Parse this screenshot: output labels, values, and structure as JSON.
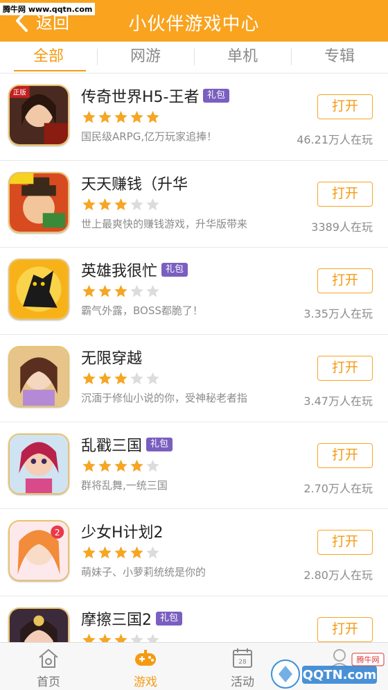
{
  "watermark_top": "腾牛网 www.qqtn.com",
  "header": {
    "back_label": "返回",
    "title": "小伙伴游戏中心",
    "color": "#f9a31f"
  },
  "tabs": [
    {
      "label": "全部",
      "active": true
    },
    {
      "label": "网游",
      "active": false
    },
    {
      "label": "单机",
      "active": false
    },
    {
      "label": "专辑",
      "active": false
    }
  ],
  "apps": [
    {
      "name": "传奇世界H5-王者",
      "gift": "礼包",
      "rating": 5,
      "desc": "国民级ARPG,亿万玩家追捧！",
      "players": "46.21万人在玩",
      "button": "打开",
      "icon": "legend-world-icon"
    },
    {
      "name": "天天赚钱（升华",
      "gift": "",
      "rating": 3,
      "desc": "世上最爽快的赚钱游戏，升华版带来",
      "players": "3389人在玩",
      "button": "打开",
      "icon": "make-money-icon"
    },
    {
      "name": "英雄我很忙",
      "gift": "礼包",
      "rating": 3,
      "desc": "霸气外露，BOSS都脆了！",
      "players": "3.35万人在玩",
      "button": "打开",
      "icon": "hero-busy-icon"
    },
    {
      "name": "无限穿越",
      "gift": "",
      "rating": 3,
      "desc": "沉湎于修仙小说的你，受神秘老者指",
      "players": "3.47万人在玩",
      "button": "打开",
      "icon": "infinite-travel-icon"
    },
    {
      "name": "乱戳三国",
      "gift": "礼包",
      "rating": 4,
      "desc": "群将乱舞,一统三国",
      "players": "2.70万人在玩",
      "button": "打开",
      "icon": "three-kingdoms-icon"
    },
    {
      "name": "少女H计划2",
      "gift": "",
      "rating": 4,
      "desc": "萌妹子、小萝莉统统是你的",
      "players": "2.80万人在玩",
      "button": "打开",
      "icon": "girl-plan-icon"
    },
    {
      "name": "摩擦三国2",
      "gift": "礼包",
      "rating": 3,
      "desc": "",
      "players": "",
      "button": "打开",
      "icon": "friction-kingdoms-icon"
    }
  ],
  "bottom_nav": [
    {
      "label": "首页",
      "icon": "home-icon",
      "active": false
    },
    {
      "label": "游戏",
      "icon": "gamepad-icon",
      "active": true
    },
    {
      "label": "活动",
      "icon": "calendar-icon",
      "active": false
    },
    {
      "label": "",
      "icon": "profile-icon",
      "active": false
    }
  ],
  "watermark_bottom": {
    "badge": "腾牛网",
    "text": "QQTN.com"
  },
  "colors": {
    "accent": "#f59a11",
    "star": "#f5a623",
    "star_empty": "#dcdcdc",
    "gift": "#7a5fc0"
  }
}
